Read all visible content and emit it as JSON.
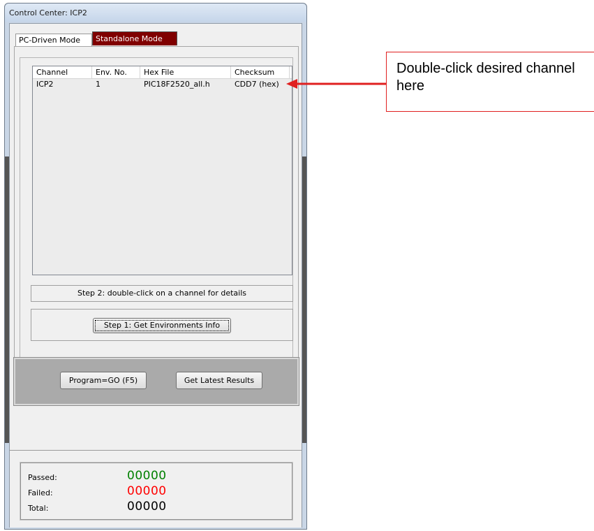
{
  "window": {
    "title": "Control Center: ICP2"
  },
  "tabs": [
    {
      "label": "PC-Driven Mode"
    },
    {
      "label": "Standalone Mode"
    }
  ],
  "list": {
    "columns": [
      "Channel",
      "Env. No.",
      "Hex File",
      "Checksum"
    ],
    "rows": [
      {
        "channel": "ICP2",
        "env": "1",
        "hexfile": "PIC18F2520_all.h",
        "checksum": "CDD7 (hex)"
      }
    ]
  },
  "status_text": "Step 2: double-click on a channel for details",
  "buttons": {
    "get_env": "Step 1: Get Environments Info",
    "program": "Program=GO (F5)",
    "latest": "Get Latest Results"
  },
  "counters": {
    "passed_label": "Passed:",
    "passed_value": "00000",
    "failed_label": "Failed:",
    "failed_value": "00000",
    "total_label": "Total:",
    "total_value": "00000"
  },
  "colors": {
    "active_tab": "#800000",
    "passed": "#008000",
    "failed": "#ff0000",
    "total": "#000000",
    "annotation": "#e02020"
  },
  "annotation": {
    "text": "Double-click desired channel here"
  }
}
